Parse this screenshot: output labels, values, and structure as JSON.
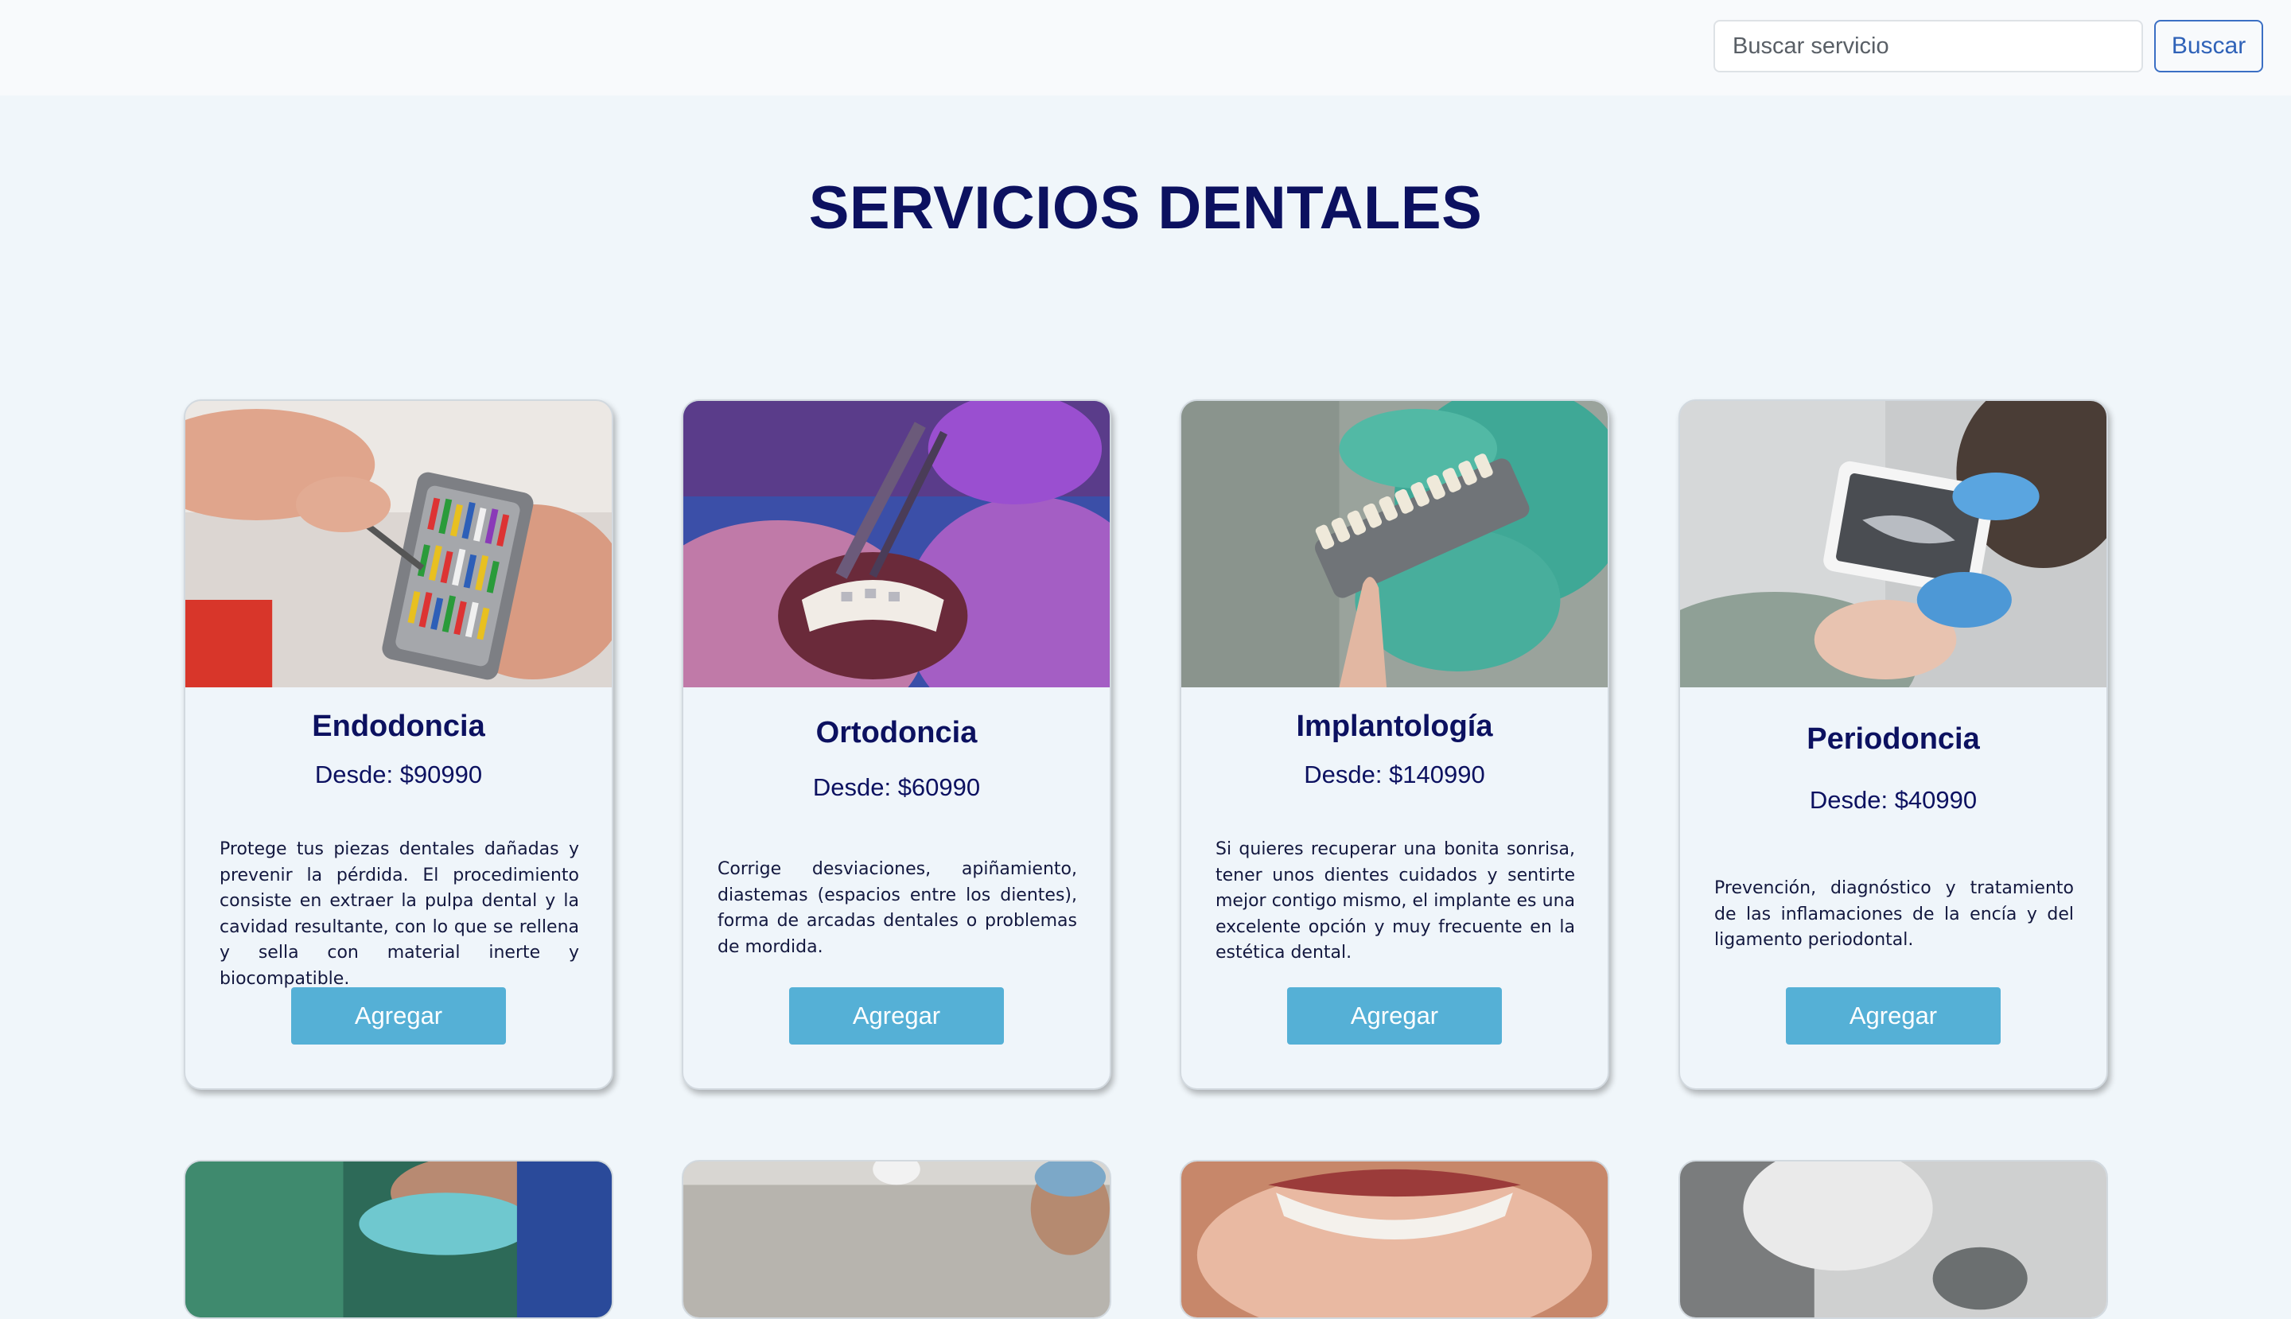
{
  "search": {
    "placeholder": "Buscar servicio",
    "button_label": "Buscar"
  },
  "page": {
    "title": "SERVICIOS DENTALES"
  },
  "services": [
    {
      "title": "Endodoncia",
      "price": "Desde: $90990",
      "description": "Protege tus piezas dentales dañadas y prevenir la pérdida. El procedimiento consiste en extraer la pulpa dental y la cavidad resultante, con lo que se rellena y sella con material inerte y biocompatible.",
      "button_label": "Agregar"
    },
    {
      "title": "Ortodoncia",
      "price": "Desde: $60990",
      "description": "Corrige desviaciones, apiñamiento, diastemas (espacios entre los dientes), forma de arcadas dentales o problemas de mordida.",
      "button_label": "Agregar"
    },
    {
      "title": "Implantología",
      "price": "Desde: $140990",
      "description": "Si quieres recuperar una bonita sonrisa, tener unos dientes cuidados y sentirte mejor contigo mismo, el implante es una excelente opción y muy frecuente en la estética dental.",
      "button_label": "Agregar"
    },
    {
      "title": "Periodoncia",
      "price": "Desde: $40990",
      "description": "Prevención, diagnóstico y tratamiento de las inflamaciones de la encía y del ligamento periodontal.",
      "button_label": "Agregar"
    }
  ],
  "colors": {
    "title": "#0c1160",
    "button": "#55b0d6",
    "background": "#f0f6fa",
    "search_accent": "#2f62b8"
  }
}
